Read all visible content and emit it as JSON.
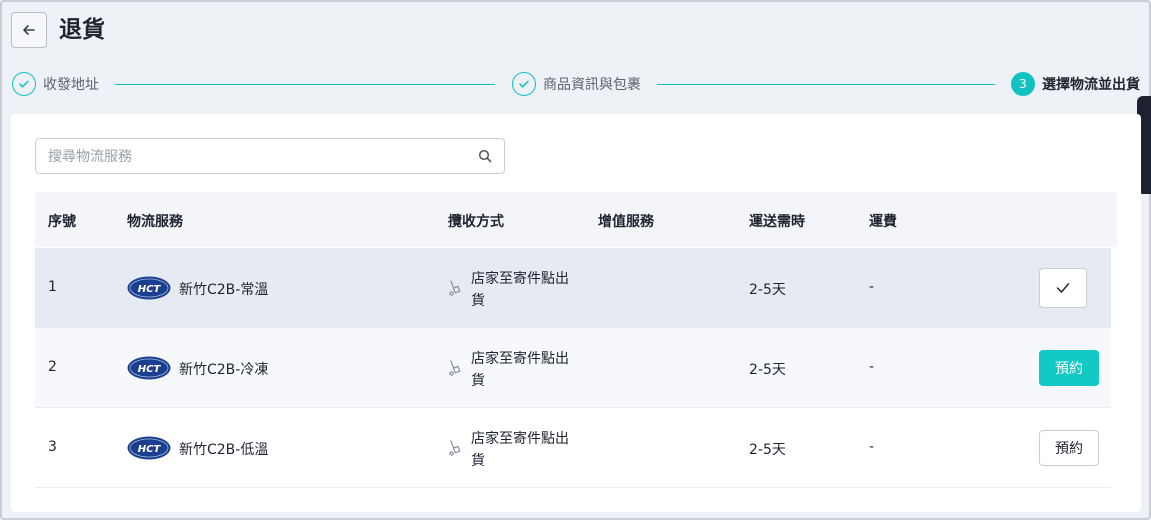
{
  "header": {
    "title": "退貨"
  },
  "steps": [
    {
      "label": "收發地址",
      "status": "done"
    },
    {
      "label": "商品資訊與包裹",
      "status": "done"
    },
    {
      "label": "選擇物流並出貨",
      "status": "active",
      "number": "3"
    }
  ],
  "search": {
    "placeholder": "搜尋物流服務",
    "value": ""
  },
  "table": {
    "headers": [
      "序號",
      "物流服務",
      "攬收方式",
      "增值服務",
      "運送需時",
      "運費"
    ],
    "rows": [
      {
        "num": "1",
        "logo_text": "HCT",
        "service": "新竹C2B-常溫",
        "pickup": "店家至寄件點出貨",
        "duration": "2-5天",
        "fee": "-",
        "action": "selected"
      },
      {
        "num": "2",
        "logo_text": "HCT",
        "service": "新竹C2B-冷凍",
        "pickup": "店家至寄件點出貨",
        "duration": "2-5天",
        "fee": "-",
        "action": "預約"
      },
      {
        "num": "3",
        "logo_text": "HCT",
        "service": "新竹C2B-低溫",
        "pickup": "店家至寄件點出貨",
        "duration": "2-5天",
        "fee": "-",
        "action": "預約"
      }
    ]
  },
  "colors": {
    "accent": "#12c9c6",
    "brand_logo": "#1b3f8f",
    "selected_row": "#e6ebf3"
  }
}
